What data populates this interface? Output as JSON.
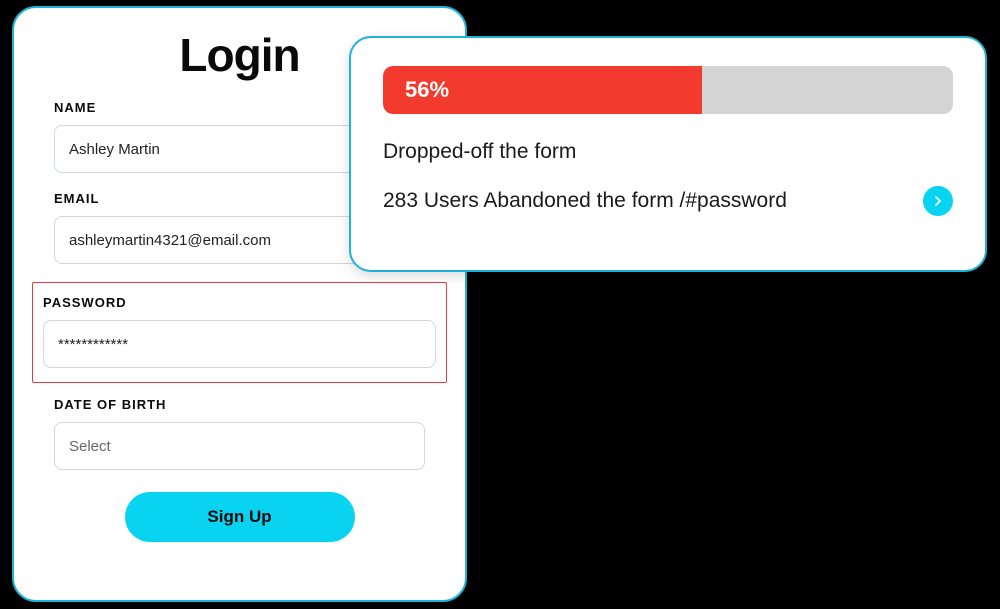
{
  "login": {
    "title": "Login",
    "fields": {
      "name": {
        "label": "NAME",
        "value": "Ashley Martin"
      },
      "email": {
        "label": "EMAIL",
        "value": "ashleymartin4321@email.com"
      },
      "password": {
        "label": "PASSWORD",
        "value": "************"
      },
      "dob": {
        "label": "DATE OF BIRTH",
        "placeholder": "Select"
      }
    },
    "signup_label": "Sign Up"
  },
  "analytics": {
    "progress_percent": "56%",
    "progress_width": "56%",
    "text1": "Dropped-off the form",
    "text2": "283 Users Abandoned the form /#password"
  },
  "chart_data": {
    "type": "bar",
    "title": "Form drop-off",
    "categories": [
      "Dropped-off"
    ],
    "values": [
      56
    ],
    "ylim": [
      0,
      100
    ],
    "ylabel": "%",
    "annotations": [
      "283 Users Abandoned the form /#password"
    ]
  }
}
